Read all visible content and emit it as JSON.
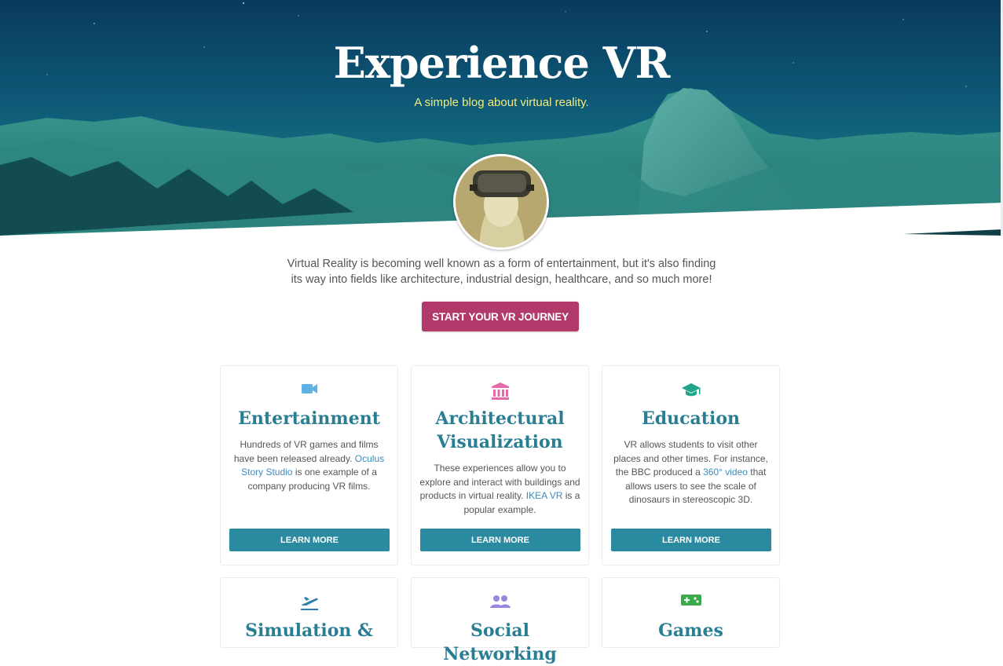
{
  "hero": {
    "title": "Experience VR",
    "subtitle": "A simple blog about virtual reality."
  },
  "intro": {
    "line1": "Virtual Reality is becoming well known as a form of entertainment, but it's also finding",
    "line2": "its way into fields like architecture, industrial design, healthcare, and so much more!"
  },
  "cta": {
    "label": "START YOUR VR JOURNEY"
  },
  "colors": {
    "accent": "#b13a6b",
    "heading": "#2a7e93",
    "button": "#2a8aa0",
    "link": "#3d8ab8",
    "subtitle": "#f3ec7a"
  },
  "cards": [
    {
      "icon": "video-camera-icon",
      "title_lines": [
        "Entertainment"
      ],
      "text_before": "Hundreds of VR games and films have been released already. ",
      "link": "Oculus Story Studio",
      "text_after": " is one example of a company producing VR films.",
      "button": "LEARN MORE"
    },
    {
      "icon": "bank-icon",
      "title_lines": [
        "Architectural",
        "Visualization"
      ],
      "text_before": "These experiences allow you to explore and interact with buildings and products in virtual reality. ",
      "link": "IKEA VR",
      "text_after": " is a popular example.",
      "button": "LEARN MORE"
    },
    {
      "icon": "graduation-cap-icon",
      "title_lines": [
        "Education"
      ],
      "text_before": "VR allows students to visit other places and other times. For instance, the BBC produced a ",
      "link": "360° video",
      "text_after": " that allows users to see the scale of dinosaurs in stereoscopic 3D.",
      "button": "LEARN MORE"
    },
    {
      "icon": "airplane-takeoff-icon",
      "title_lines": [
        "Simulation &"
      ]
    },
    {
      "icon": "users-icon",
      "title_lines": [
        "Social Networking"
      ]
    },
    {
      "icon": "gamepad-icon",
      "title_lines": [
        "Games"
      ]
    }
  ]
}
